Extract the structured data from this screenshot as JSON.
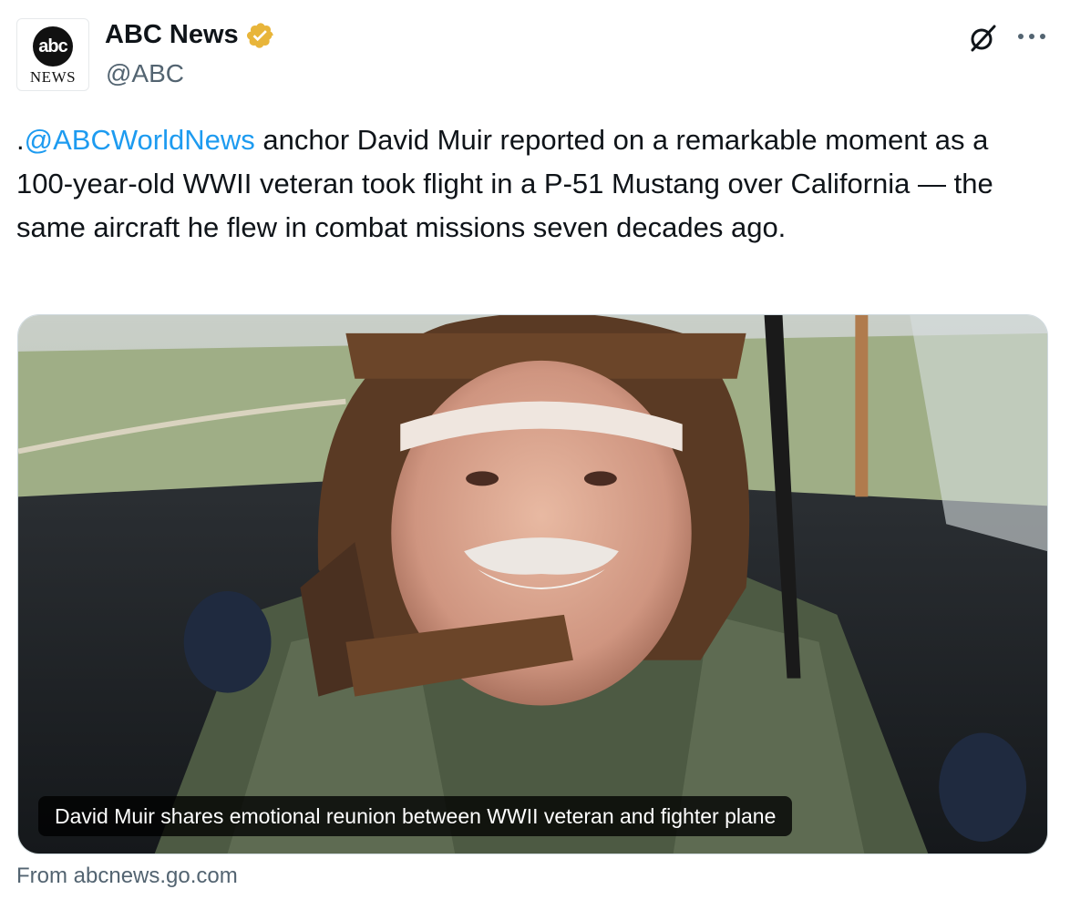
{
  "author": {
    "display_name": "ABC News",
    "handle": "@ABC",
    "avatar_logo_text": "abc",
    "avatar_news_text": "NEWS",
    "verified_badge_color": "#e8b53a"
  },
  "actions": {
    "grok_icon": "grok-slash-circle-icon",
    "more_icon": "more-dots-icon"
  },
  "tweet": {
    "prefix": ".",
    "mention": "@ABCWorldNews",
    "body": " anchor David Muir reported on a remarkable moment as a 100-year-old WWII veteran took flight in a P-51 Mustang over California — the same aircraft he flew in combat missions seven decades ago."
  },
  "media": {
    "caption": "David Muir shares emotional reunion between WWII veteran and fighter plane"
  },
  "link_source": "From abcnews.go.com",
  "colors": {
    "text": "#0f1419",
    "secondary": "#536471",
    "link": "#1d9bf0",
    "border": "#cfd9de"
  }
}
